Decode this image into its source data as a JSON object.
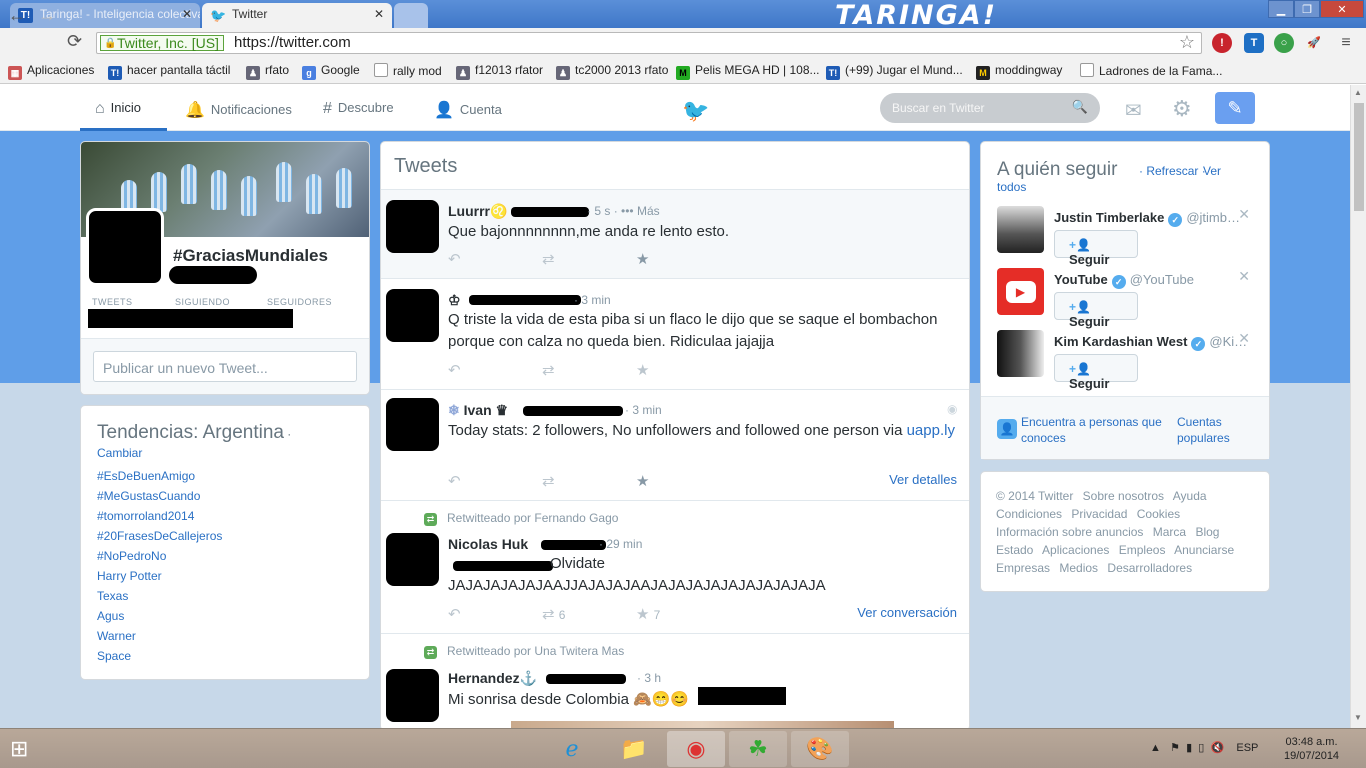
{
  "tabs": [
    {
      "label": "Taringa! - Inteligencia colectiva",
      "icon": "taringa-icon"
    },
    {
      "label": "Twitter",
      "icon": "twitter-bird-icon"
    },
    {
      "label": "",
      "icon": "new-tab-icon"
    }
  ],
  "titlebar_logo": "TARINGA!",
  "toolbar": {
    "ev_label": "Twitter, Inc. [US]",
    "url": "https://twitter.com"
  },
  "bookmarks": [
    {
      "label": "Aplicaciones",
      "icon": "apps-icon"
    },
    {
      "label": "hacer pantalla táctil",
      "icon": "taringa-icon"
    },
    {
      "label": "rfato",
      "icon": "person-icon"
    },
    {
      "label": "Google",
      "icon": "google-icon"
    },
    {
      "label": "rally mod",
      "icon": "page-icon"
    },
    {
      "label": "f12013 rfator",
      "icon": "person-icon"
    },
    {
      "label": "tc2000 2013 rfato",
      "icon": "person-icon"
    },
    {
      "label": "Pelis MEGA HD | 108...",
      "icon": "film-icon"
    },
    {
      "label": "(+99) Jugar el Mund...",
      "icon": "taringa-icon"
    },
    {
      "label": "moddingway",
      "icon": "m-icon"
    },
    {
      "label": "Ladrones de la Fama...",
      "icon": "page-icon"
    }
  ],
  "nav": {
    "home": "Inicio",
    "notifications": "Notificaciones",
    "discover": "Descubre",
    "account": "Cuenta",
    "search_placeholder": "Buscar en Twitter"
  },
  "profile": {
    "name": "#GraciasMundiales",
    "stats_labels": [
      "TWEETS",
      "SIGUIENDO",
      "SEGUIDORES"
    ],
    "compose_placeholder": "Publicar un nuevo Tweet..."
  },
  "trends": {
    "title": "Tendencias: Argentina",
    "change": "Cambiar",
    "items": [
      "#EsDeBuenAmigo",
      "#MeGustasCuando",
      "#tomorroland2014",
      "#20FrasesDeCallejeros",
      "#NoPedroNo",
      "Harry Potter",
      "Texas",
      "Agus",
      "Warner",
      "Space"
    ]
  },
  "stream": {
    "title": "Tweets",
    "tweets": [
      {
        "name": "Luurrr♌",
        "time": "5 s",
        "more": "Más",
        "text": "Que bajonnnnnnnn,me anda re lento esto.",
        "rt_count": "",
        "fav_count": "",
        "link": ""
      },
      {
        "name": "♔",
        "time": "3 min",
        "text": "Q triste la vida de esta piba si un flaco le dijo que se saque el bombachon porque con calza no queda bien. Ridiculaa jajajja",
        "rt_count": "",
        "fav_count": "",
        "link": ""
      },
      {
        "name": "Ivan ♛",
        "time": "3 min",
        "text": "Today stats: 2 followers, No unfollowers and followed one person via",
        "url": "uapp.ly",
        "rt_count": "",
        "fav_count": "",
        "link": "Ver detalles"
      },
      {
        "retweeted_by": "Retwitteado por Fernando Gago",
        "name": "Nicolas Huk",
        "time": "29 min",
        "text": "Olvidate JAJAJAJAJAJAAJJAJAJAJAAJAJAJAJAJAJAJAJAJAJA",
        "rt_count": "6",
        "fav_count": "7",
        "link": "Ver conversación"
      },
      {
        "retweeted_by": "Retwitteado por Una Twitera Mas",
        "name": "Hernandez⚓",
        "time": "3 h",
        "text": "Mi sonrisa desde Colombia 🙈😁😊"
      }
    ]
  },
  "who_to_follow": {
    "title": "A quién seguir",
    "refresh": "Refrescar",
    "view_all": "Ver todos",
    "follow_label": "Seguir",
    "accounts": [
      {
        "name": "Justin Timberlake",
        "handle": "@jtimb…"
      },
      {
        "name": "YouTube",
        "handle": "@YouTube"
      },
      {
        "name": "Kim Kardashian West",
        "handle": "@Ki…"
      }
    ],
    "find_people": "Encuentra a personas que conoces",
    "popular": "Cuentas populares"
  },
  "footer": [
    "© 2014 Twitter",
    "Sobre nosotros",
    "Ayuda",
    "Condiciones",
    "Privacidad",
    "Cookies",
    "Información sobre anuncios",
    "Marca",
    "Blog",
    "Estado",
    "Aplicaciones",
    "Empleos",
    "Anunciarse",
    "Empresas",
    "Medios",
    "Desarrolladores"
  ],
  "taskbar": {
    "lang": "ESP",
    "time": "03:48 a.m.",
    "date": "19/07/2014"
  },
  "colors": {
    "twitter_blue": "#55acee",
    "link": "#2a70c4",
    "background_top": "#5f9ee8"
  }
}
